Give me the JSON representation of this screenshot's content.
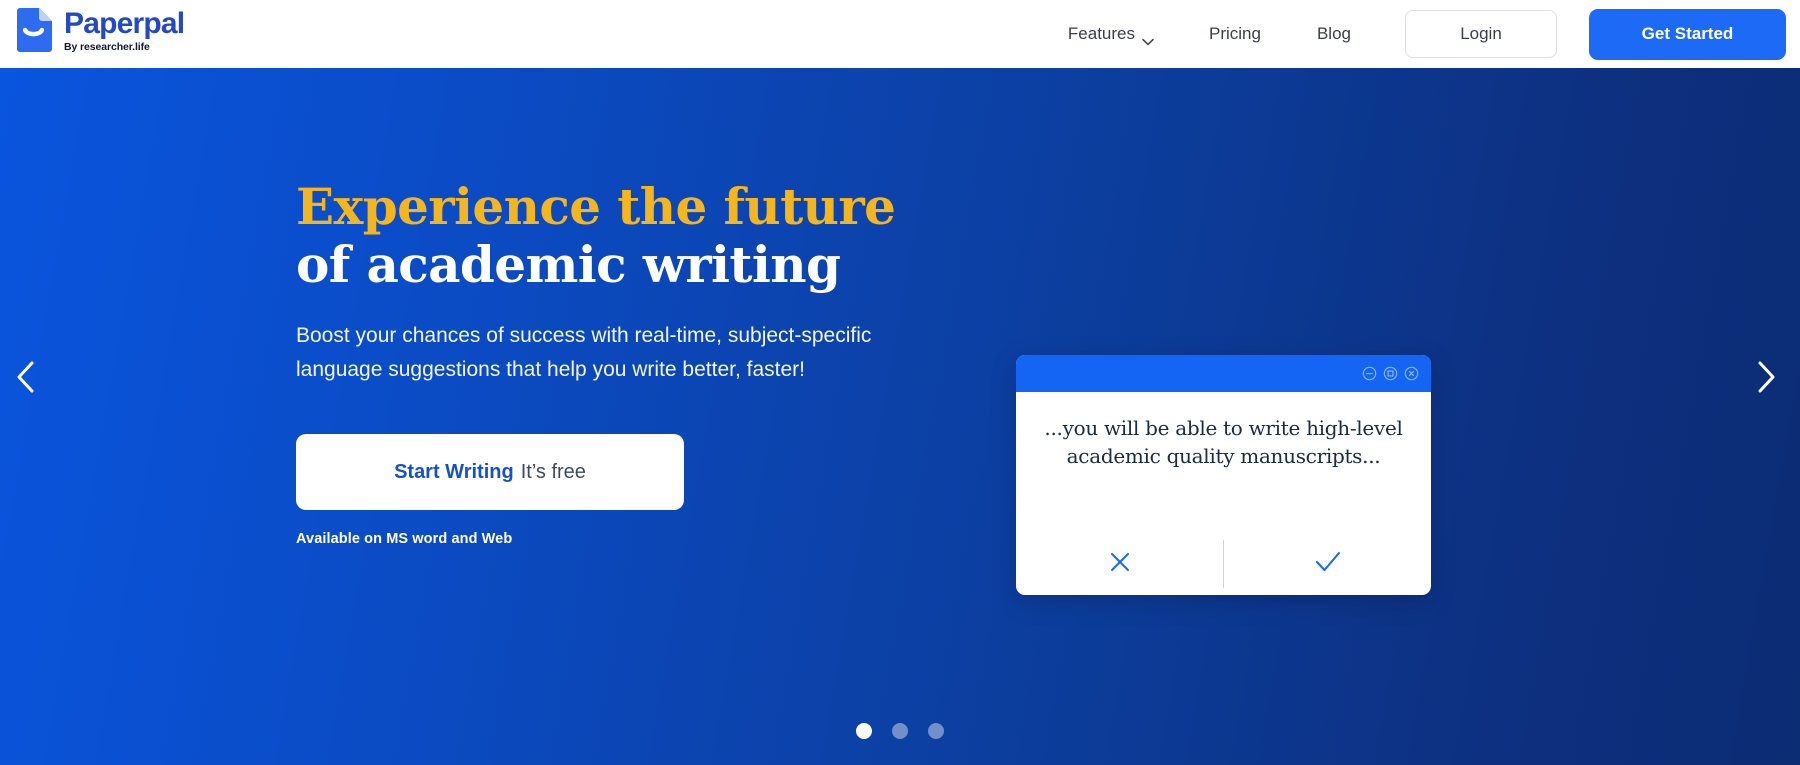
{
  "brand": {
    "name": "Paperpal",
    "tagline": "By researcher.life",
    "logo_icon": "paper-smile-icon",
    "accent_blue": "#1C6AF5",
    "logo_blue": "#2449C4"
  },
  "nav": {
    "links": [
      {
        "label": "Features",
        "has_dropdown": true,
        "icon": "chevron-down-icon"
      },
      {
        "label": "Pricing",
        "has_dropdown": false
      },
      {
        "label": "Blog",
        "has_dropdown": false
      }
    ],
    "login_label": "Login",
    "get_started_label": "Get Started"
  },
  "hero": {
    "headline_line1": "Experience the future",
    "headline_line2": "of academic writing",
    "headline_accent_color": "#F4B61C",
    "subcopy_line1": "Boost your chances of success with real-time, subject-specific",
    "subcopy_line2": "language suggestions that help you write better, faster!",
    "cta_strong": "Start Writing",
    "cta_light": "It’s free",
    "availability": "Available on MS word and Web",
    "background_gradient_from": "#0A55DE",
    "background_gradient_to": "#0C2C74"
  },
  "mock_window": {
    "titlebar_color": "#1565F5",
    "controls": [
      {
        "icon": "minimize-circle-icon",
        "glyph": "minimize"
      },
      {
        "icon": "maximize-circle-icon",
        "glyph": "maximize"
      },
      {
        "icon": "close-circle-icon",
        "glyph": "close"
      }
    ],
    "suggestion_line1": "...you will be able to write high-level",
    "suggestion_line2": "academic quality manuscripts...",
    "reject_icon": "close-x-icon",
    "accept_icon": "check-icon"
  },
  "carousel": {
    "prev_icon": "chevron-left-icon",
    "next_icon": "chevron-right-icon",
    "slide_count": 3,
    "active_slide": 1,
    "dots": [
      "active",
      "idle",
      "idle"
    ]
  }
}
